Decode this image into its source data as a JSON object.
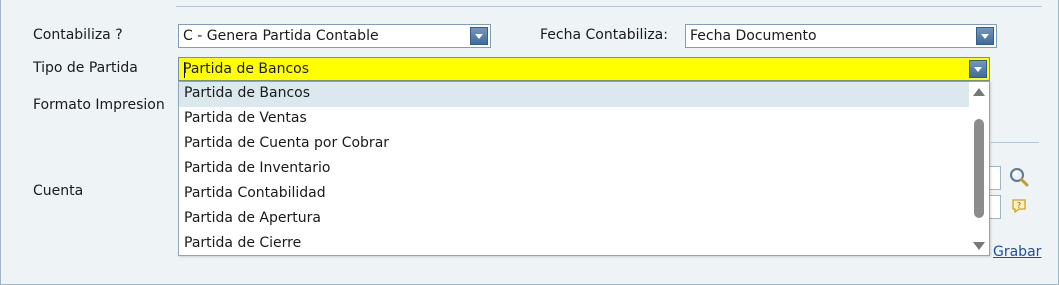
{
  "form": {
    "contabiliza_label": "Contabiliza ?",
    "contabiliza_value": "C - Genera Partida Contable",
    "fecha_label": "Fecha Contabiliza:",
    "fecha_value": "Fecha Documento",
    "tipo_label": "Tipo de Partida",
    "tipo_value": "Partida de Bancos",
    "formato_label": "Formato Impresion",
    "cuenta_label": "Cuenta",
    "grabar_label": "Grabar"
  },
  "dropdown": {
    "options": [
      "Partida de Bancos",
      "Partida de Ventas",
      "Partida de Cuenta por Cobrar",
      "Partida de Inventario",
      "Partida Contabilidad",
      "Partida de Apertura",
      "Partida de Cierre"
    ],
    "selected_index": 0
  },
  "icons": {
    "search": "magnifier-icon",
    "help": "note-icon"
  },
  "colors": {
    "active_field": "#ffff00",
    "selected_option": "#dbe9ee",
    "link": "#1f4e9c"
  }
}
